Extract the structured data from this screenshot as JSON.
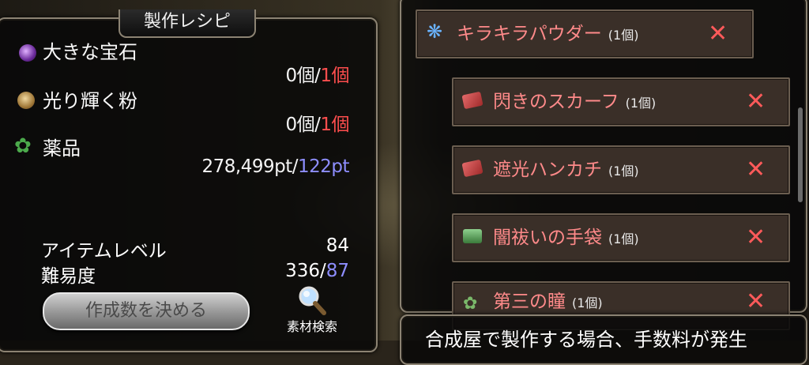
{
  "left": {
    "title": "製作レシピ",
    "materials": [
      {
        "name": "大きな宝石",
        "have": "0個",
        "sep": "/",
        "need": "1個",
        "icon": "gem-icon"
      },
      {
        "name": "光り輝く粉",
        "have": "0個",
        "sep": "/",
        "need": "1個",
        "icon": "powder-bag-icon"
      },
      {
        "name": "薬品",
        "have": "278,499pt",
        "sep": "/",
        "need": "122pt",
        "icon": "herb-icon"
      }
    ],
    "item_level_label": "アイテムレベル",
    "item_level_value": "84",
    "difficulty_label": "難易度",
    "difficulty_have": "336",
    "difficulty_sep": "/",
    "difficulty_need": "87",
    "make_button": "作成数を決める",
    "search_label": "素材検索"
  },
  "right": {
    "root": {
      "name": "キラキラパウダー",
      "count": "(1個)"
    },
    "children": [
      {
        "name": "閃きのスカーフ",
        "count": "(1個)"
      },
      {
        "name": "遮光ハンカチ",
        "count": "(1個)"
      },
      {
        "name": "闇祓いの手袋",
        "count": "(1個)"
      },
      {
        "name": "第三の瞳",
        "count": "(1個)"
      }
    ],
    "remove_symbol": "✕",
    "bottom_message": "合成屋で製作する場合、手数料が発生"
  },
  "colors": {
    "need": "#ff4e4e",
    "points_need": "#8e8eff",
    "item_name": "#ff8a8a"
  }
}
